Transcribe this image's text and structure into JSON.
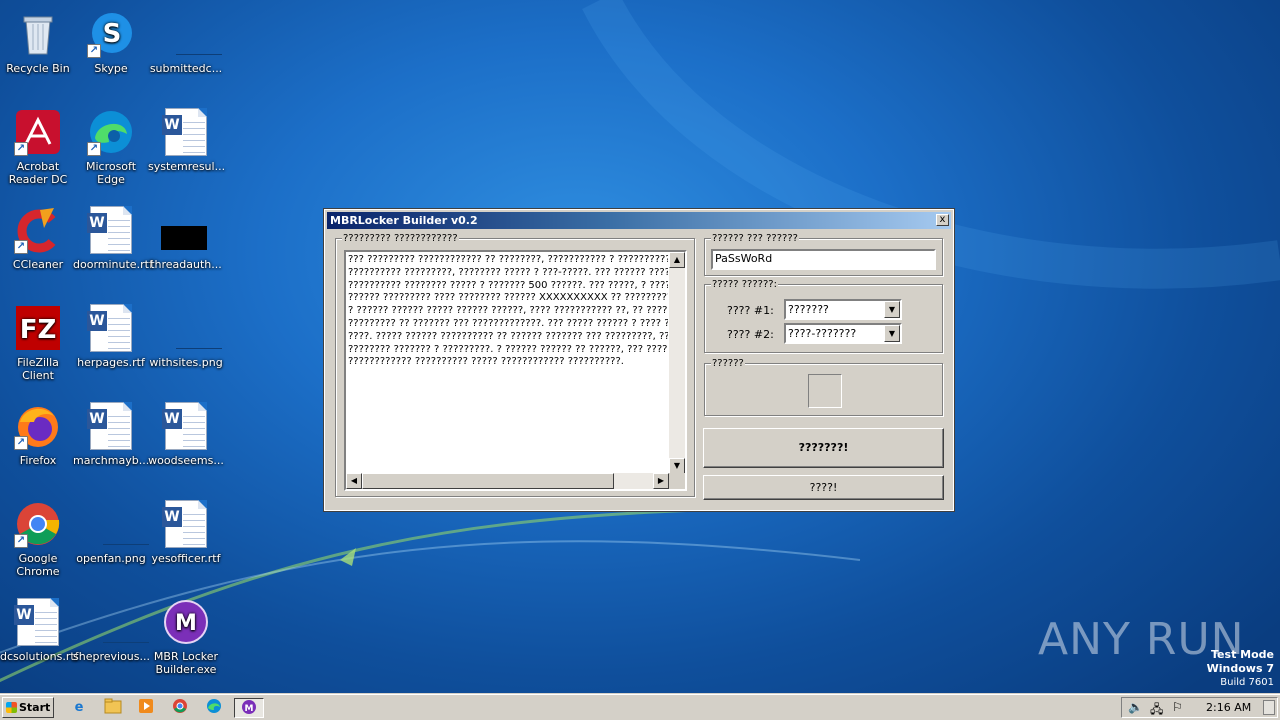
{
  "desktop": {
    "icons": [
      {
        "label": "Recycle Bin",
        "icon": "recycle-bin-icon"
      },
      {
        "label": "Skype",
        "icon": "skype-icon"
      },
      {
        "label": "submittedc...",
        "icon": "blank-file-icon"
      },
      {
        "label": "Acrobat Reader DC",
        "icon": "acrobat-icon"
      },
      {
        "label": "Microsoft Edge",
        "icon": "edge-icon"
      },
      {
        "label": "systemresul...",
        "icon": "word-doc-icon"
      },
      {
        "label": "CCleaner",
        "icon": "ccleaner-icon"
      },
      {
        "label": "doorminute.rtf",
        "icon": "word-doc-icon"
      },
      {
        "label": "threadauth...",
        "icon": "black-image-icon"
      },
      {
        "label": "FileZilla Client",
        "icon": "filezilla-icon"
      },
      {
        "label": "herpages.rtf",
        "icon": "word-doc-icon"
      },
      {
        "label": "withsites.png",
        "icon": "blank-file-icon"
      },
      {
        "label": "Firefox",
        "icon": "firefox-icon"
      },
      {
        "label": "marchmayb...",
        "icon": "word-doc-icon"
      },
      {
        "label": "woodseems...",
        "icon": "word-doc-icon"
      },
      {
        "label": "Google Chrome",
        "icon": "chrome-icon"
      },
      {
        "label": "openfan.png",
        "icon": "blank-file-icon"
      },
      {
        "label": "yesofficer.rtf",
        "icon": "word-doc-icon"
      },
      {
        "label": "dcsolutions.rtf",
        "icon": "word-doc-icon"
      },
      {
        "label": "sheprevious...",
        "icon": "blank-file-icon"
      },
      {
        "label": "MBR Locker Builder.exe",
        "icon": "mbr-locker-icon"
      }
    ]
  },
  "window": {
    "title": "MBRLocker Builder v0.2",
    "close_glyph": "x",
    "message_group_caption": "????????? ????????????",
    "message_text": "??? ????????? ???????????? ?? ????????, ??????????? ? ?????????????\n?????????? ?????????, ???????? ????? ? ???-?????. ??? ?????? ??????\n?????????? ???????? ????? ? ??????? 500 ??????. ??? ?????, ? ?????\n?????? ????????? ???? ???????? ?????? XXXXXXXXXX ?? ????????? ??\n? ?????? ?????? ????? ?????? ??????, ???? ??????????? ??, ?? ???????\n????????? ?? ??????? ??? ?????????????. ??? ????? ?????? ? ???? ? ??\n????. ????? ?????? ?????????? ?? ?????? ??????? ??? ?????????, ?????\n???????? ??????? ? ?????????. ? ?????? ?????? ?? ??????, ??? ??????\n???????????? ?????????? ????? ???????????? ??????????.",
    "password_group_caption": "?????? ??? ??????",
    "password_value": "PaSsWoRd",
    "options_group_caption": "????? ??????:",
    "option1_label": "???? #1:",
    "option1_value": "???????",
    "option2_label": "???? #2:",
    "option2_value": "????-???????",
    "icon_group_caption": "??????",
    "build_button": "???????!",
    "exit_button": "????!"
  },
  "taskbar": {
    "start_label": "Start",
    "quick_launch": [
      "ie-icon",
      "explorer-icon",
      "media-player-icon",
      "chrome-icon",
      "edge-icon",
      "mbr-locker-icon"
    ],
    "clock": "2:16 AM"
  },
  "watermark": {
    "brand": "ANY RUN",
    "line1": "Test Mode",
    "line2": "Windows 7",
    "line3": "Build 7601"
  }
}
